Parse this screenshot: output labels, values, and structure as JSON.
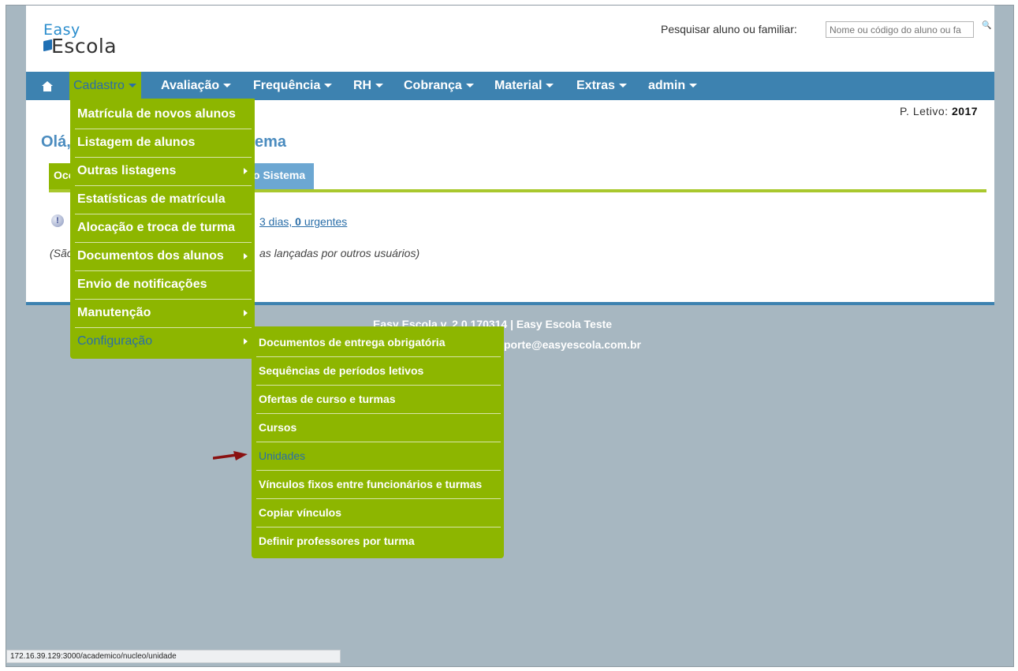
{
  "logo": {
    "line1": "Easy",
    "line2": "Escola"
  },
  "search": {
    "label": "Pesquisar aluno ou familiar:",
    "placeholder": "Nome ou código do aluno ou fa"
  },
  "nav": {
    "items": [
      {
        "label": "Cadastro"
      },
      {
        "label": "Avaliação"
      },
      {
        "label": "Frequência"
      },
      {
        "label": "RH"
      },
      {
        "label": "Cobrança"
      },
      {
        "label": "Material"
      },
      {
        "label": "Extras"
      },
      {
        "label": "admin"
      }
    ]
  },
  "periodo": {
    "label": "P. Letivo:",
    "value": "2017"
  },
  "main": {
    "greeting_start": "Olá,",
    "greeting_end": "ema",
    "tab_left": "Oco",
    "tab_right": "o Sistema",
    "ocorrencias_link_prefix": "3 dias, ",
    "ocorrencias_urgent_count": "0",
    "ocorrencias_urgent_label": " urgentes",
    "note_start": "(São",
    "note_end": "as lançadas por outros usuários)"
  },
  "footer": {
    "line1_prefix": "Easy Escola v. 2.0.170314 | ",
    "line1_school": "Easy Escola Teste",
    "line2": "porte@easyescola.com.br"
  },
  "cadastro_menu": [
    {
      "label": "Matrícula de novos alunos"
    },
    {
      "label": "Listagem de alunos"
    },
    {
      "label": "Outras listagens"
    },
    {
      "label": "Estatísticas de matrícula"
    },
    {
      "label": "Alocação e troca de turma"
    },
    {
      "label": "Documentos dos alunos"
    },
    {
      "label": "Envio de notificações"
    },
    {
      "label": "Manutenção"
    },
    {
      "label": "Configuração"
    }
  ],
  "configuracao_menu": [
    {
      "label": "Documentos de entrega obrigatória"
    },
    {
      "label": "Sequências de períodos letivos"
    },
    {
      "label": "Ofertas de curso e turmas"
    },
    {
      "label": "Cursos"
    },
    {
      "label": "Unidades"
    },
    {
      "label": "Vínculos fixos entre funcionários e turmas"
    },
    {
      "label": "Copiar vínculos"
    },
    {
      "label": "Definir professores por turma"
    }
  ],
  "status_bar": {
    "url": "172.16.39.129:3000/academico/nucleo/unidade"
  },
  "colors": {
    "nav_blue": "#3d82b0",
    "menu_green": "#8db600",
    "link_blue": "#2a6ea8",
    "bg_gray": "#a7b7c1"
  }
}
